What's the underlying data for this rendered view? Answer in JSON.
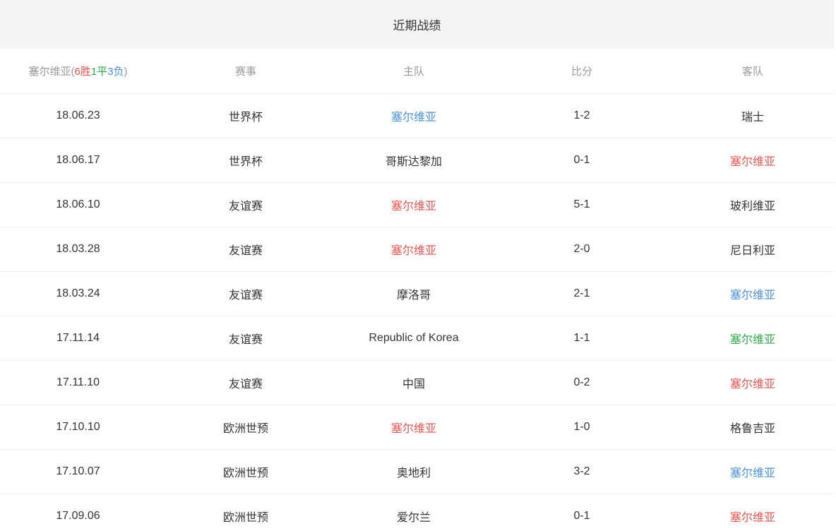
{
  "title": "近期战绩",
  "header": {
    "team_name": "塞尔维亚",
    "record_open": "(",
    "wins": "6",
    "wins_label": "胜",
    "draws": "1",
    "draws_label": "平",
    "losses": "3",
    "losses_label": "负",
    "record_close": ")",
    "competition": "赛事",
    "home": "主队",
    "score": "比分",
    "away": "客队"
  },
  "colors": {
    "win": "#e8534f",
    "draw": "#2fa84a",
    "loss": "#4a90d9",
    "text": "#333333",
    "header_text": "#999999",
    "title_bg": "#f4f4f4"
  },
  "matches": [
    {
      "date": "18.06.23",
      "competition": "世界杯",
      "home": "塞尔维亚",
      "score": "1-2",
      "away": "瑞士",
      "highlight": "home",
      "result": "loss"
    },
    {
      "date": "18.06.17",
      "competition": "世界杯",
      "home": "哥斯达黎加",
      "score": "0-1",
      "away": "塞尔维亚",
      "highlight": "away",
      "result": "win"
    },
    {
      "date": "18.06.10",
      "competition": "友谊赛",
      "home": "塞尔维亚",
      "score": "5-1",
      "away": "玻利维亚",
      "highlight": "home",
      "result": "win"
    },
    {
      "date": "18.03.28",
      "competition": "友谊赛",
      "home": "塞尔维亚",
      "score": "2-0",
      "away": "尼日利亚",
      "highlight": "home",
      "result": "win"
    },
    {
      "date": "18.03.24",
      "competition": "友谊赛",
      "home": "摩洛哥",
      "score": "2-1",
      "away": "塞尔维亚",
      "highlight": "away",
      "result": "loss"
    },
    {
      "date": "17.11.14",
      "competition": "友谊赛",
      "home": "Republic of Korea",
      "score": "1-1",
      "away": "塞尔维亚",
      "highlight": "away",
      "result": "draw"
    },
    {
      "date": "17.11.10",
      "competition": "友谊赛",
      "home": "中国",
      "score": "0-2",
      "away": "塞尔维亚",
      "highlight": "away",
      "result": "win"
    },
    {
      "date": "17.10.10",
      "competition": "欧洲世预",
      "home": "塞尔维亚",
      "score": "1-0",
      "away": "格鲁吉亚",
      "highlight": "home",
      "result": "win"
    },
    {
      "date": "17.10.07",
      "competition": "欧洲世预",
      "home": "奥地利",
      "score": "3-2",
      "away": "塞尔维亚",
      "highlight": "away",
      "result": "loss"
    },
    {
      "date": "17.09.06",
      "competition": "欧洲世预",
      "home": "爱尔兰",
      "score": "0-1",
      "away": "塞尔维亚",
      "highlight": "away",
      "result": "win"
    }
  ]
}
